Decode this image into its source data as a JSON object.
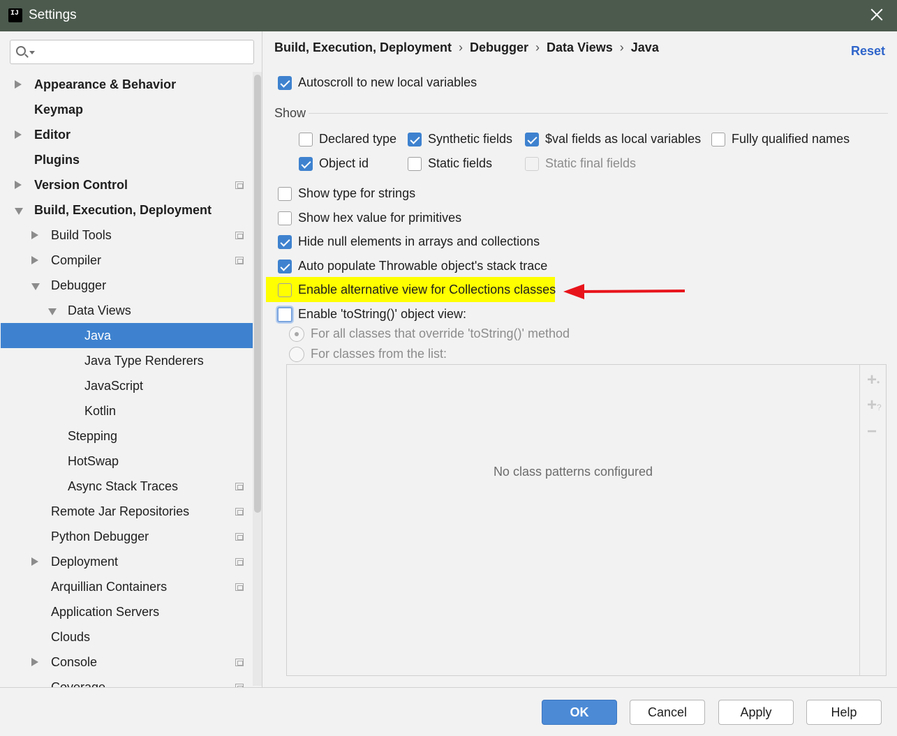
{
  "window": {
    "title": "Settings"
  },
  "search": {
    "placeholder": ""
  },
  "tree": [
    {
      "label": "Appearance & Behavior",
      "level": 0,
      "bold": true,
      "arrow": "right",
      "proj": false
    },
    {
      "label": "Keymap",
      "level": 0,
      "bold": true,
      "arrow": "",
      "proj": false
    },
    {
      "label": "Editor",
      "level": 0,
      "bold": true,
      "arrow": "right",
      "proj": false
    },
    {
      "label": "Plugins",
      "level": 0,
      "bold": true,
      "arrow": "",
      "proj": false
    },
    {
      "label": "Version Control",
      "level": 0,
      "bold": true,
      "arrow": "right",
      "proj": true
    },
    {
      "label": "Build, Execution, Deployment",
      "level": 0,
      "bold": true,
      "arrow": "down",
      "proj": false
    },
    {
      "label": "Build Tools",
      "level": 1,
      "bold": false,
      "arrow": "right",
      "proj": true
    },
    {
      "label": "Compiler",
      "level": 1,
      "bold": false,
      "arrow": "right",
      "proj": true
    },
    {
      "label": "Debugger",
      "level": 1,
      "bold": false,
      "arrow": "down",
      "proj": false
    },
    {
      "label": "Data Views",
      "level": 2,
      "bold": false,
      "arrow": "down",
      "proj": false
    },
    {
      "label": "Java",
      "level": 3,
      "bold": false,
      "arrow": "",
      "proj": false,
      "selected": true
    },
    {
      "label": "Java Type Renderers",
      "level": 3,
      "bold": false,
      "arrow": "",
      "proj": false
    },
    {
      "label": "JavaScript",
      "level": 3,
      "bold": false,
      "arrow": "",
      "proj": false
    },
    {
      "label": "Kotlin",
      "level": 3,
      "bold": false,
      "arrow": "",
      "proj": false
    },
    {
      "label": "Stepping",
      "level": 2,
      "bold": false,
      "arrow": "",
      "proj": false
    },
    {
      "label": "HotSwap",
      "level": 2,
      "bold": false,
      "arrow": "",
      "proj": false
    },
    {
      "label": "Async Stack Traces",
      "level": 2,
      "bold": false,
      "arrow": "",
      "proj": true
    },
    {
      "label": "Remote Jar Repositories",
      "level": 1,
      "bold": false,
      "arrow": "",
      "proj": true
    },
    {
      "label": "Python Debugger",
      "level": 1,
      "bold": false,
      "arrow": "",
      "proj": true
    },
    {
      "label": "Deployment",
      "level": 1,
      "bold": false,
      "arrow": "right",
      "proj": true
    },
    {
      "label": "Arquillian Containers",
      "level": 1,
      "bold": false,
      "arrow": "",
      "proj": true
    },
    {
      "label": "Application Servers",
      "level": 1,
      "bold": false,
      "arrow": "",
      "proj": false
    },
    {
      "label": "Clouds",
      "level": 1,
      "bold": false,
      "arrow": "",
      "proj": false
    },
    {
      "label": "Console",
      "level": 1,
      "bold": false,
      "arrow": "right",
      "proj": true
    },
    {
      "label": "Coverage",
      "level": 1,
      "bold": false,
      "arrow": "",
      "proj": true
    }
  ],
  "breadcrumb": [
    "Build, Execution, Deployment",
    "Debugger",
    "Data Views",
    "Java"
  ],
  "reset_label": "Reset",
  "autoscroll": {
    "label": "Autoscroll to new local variables",
    "checked": true
  },
  "show_section": {
    "title": "Show"
  },
  "show_options": {
    "declared_type": {
      "label": "Declared type",
      "checked": false
    },
    "synthetic_fields": {
      "label": "Synthetic fields",
      "checked": true
    },
    "val_fields": {
      "label": "$val fields as local variables",
      "checked": true
    },
    "fully_qualified": {
      "label": "Fully qualified names",
      "checked": false
    },
    "object_id": {
      "label": "Object id",
      "checked": true
    },
    "static_fields": {
      "label": "Static fields",
      "checked": false
    },
    "static_final_fields": {
      "label": "Static final fields",
      "checked": false,
      "disabled": true
    }
  },
  "options": {
    "type_strings": {
      "label": "Show type for strings",
      "checked": false
    },
    "hex_value": {
      "label": "Show hex value for primitives",
      "checked": false
    },
    "hide_null": {
      "label": "Hide null elements in arrays and collections",
      "checked": true
    },
    "auto_populate": {
      "label": "Auto populate Throwable object's stack trace",
      "checked": true
    },
    "alt_view": {
      "label": "Enable alternative view for Collections classes",
      "checked": false
    },
    "tostring_view": {
      "label": "Enable 'toString()' object view:",
      "checked": false
    }
  },
  "radio": {
    "all_classes": {
      "label": "For all classes that override 'toString()' method",
      "selected": true
    },
    "from_list": {
      "label": "For classes from the list:",
      "selected": false
    }
  },
  "patterns": {
    "empty_text": "No class patterns configured"
  },
  "buttons": {
    "ok": "OK",
    "cancel": "Cancel",
    "apply": "Apply",
    "help": "Help"
  },
  "colors": {
    "selection": "#3e82cf",
    "link": "#2f65ca",
    "highlight": "#ffff00",
    "annotation_arrow": "#e8141b"
  }
}
